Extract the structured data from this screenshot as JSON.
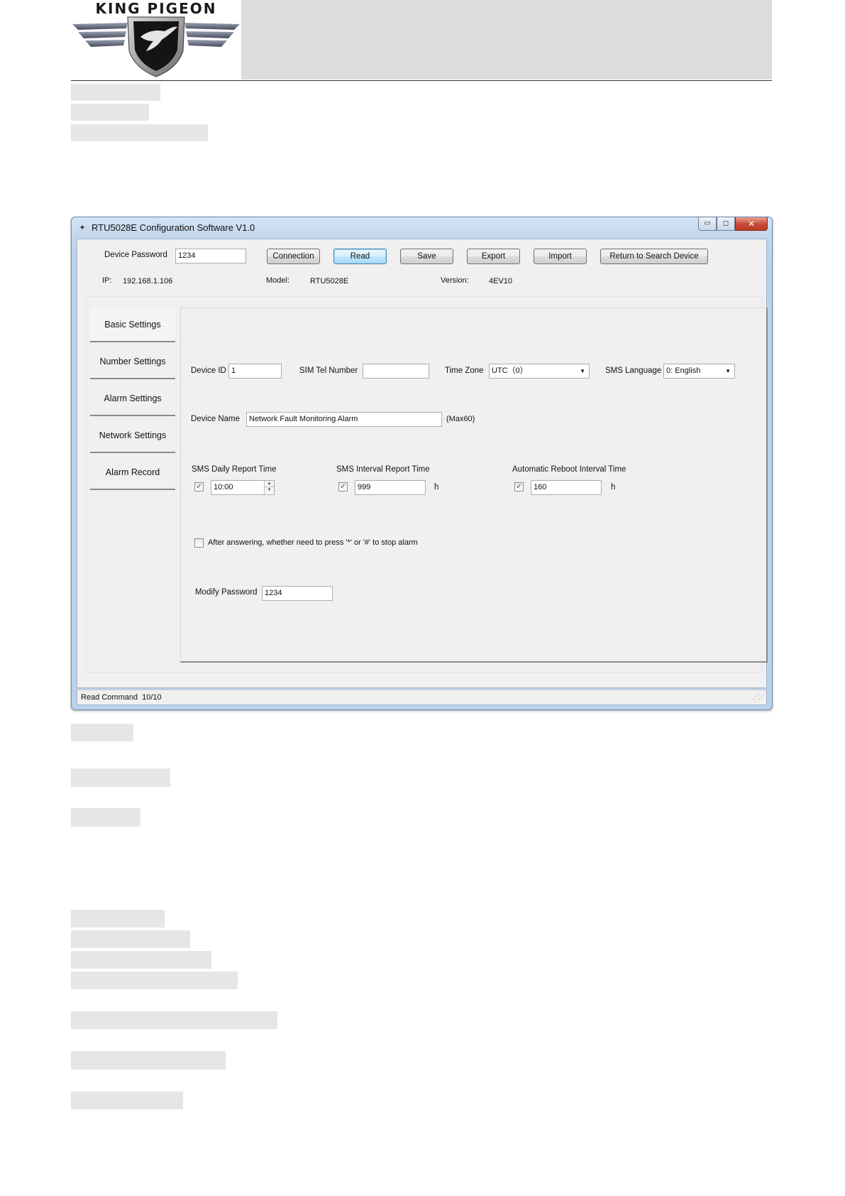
{
  "page": {
    "logo_text": "KING PIGEON"
  },
  "window": {
    "title": "RTU5028E Configuration Software V1.0",
    "title_icon": "app-icon",
    "controls": {
      "minimize": "minimize-icon",
      "maximize": "maximize-icon",
      "close": "close-icon"
    }
  },
  "toolbar": {
    "password_label": "Device Password",
    "password_value": "1234",
    "buttons": {
      "connection": "Connection",
      "read": "Read",
      "save": "Save",
      "export": "Export",
      "import": "Import",
      "return": "Return to Search Device"
    }
  },
  "info": {
    "ip_label": "IP:",
    "ip_value": "192.168.1.106",
    "model_label": "Model:",
    "model_value": "RTU5028E",
    "version_label": "Version:",
    "version_value": "4EV10"
  },
  "tabs": [
    {
      "label": "Basic Settings",
      "active": true
    },
    {
      "label": "Number Settings",
      "active": false
    },
    {
      "label": "Alarm Settings",
      "active": false
    },
    {
      "label": "Network Settings",
      "active": false
    },
    {
      "label": "Alarm Record",
      "active": false
    }
  ],
  "basic": {
    "device_id_label": "Device ID",
    "device_id_value": "1",
    "sim_label": "SIM Tel Number",
    "sim_value": "",
    "timezone_label": "Time Zone",
    "timezone_value": "UTC（0）",
    "sms_lang_label": "SMS Language",
    "sms_lang_value": "0: English",
    "device_name_label": "Device Name",
    "device_name_value": "Network Fault Monitoring Alarm",
    "device_name_hint": "(Max60)",
    "daily_report_label": "SMS Daily Report Time",
    "daily_report_checked": true,
    "daily_report_value": "10:00",
    "interval_report_label": "SMS Interval Report Time",
    "interval_report_checked": true,
    "interval_report_value": "999",
    "interval_unit": "h",
    "reboot_label": "Automatic Reboot Interval Time",
    "reboot_checked": true,
    "reboot_value": "160",
    "reboot_unit": "h",
    "answer_option_label": "After answering, whether need to press '*' or '#' to stop alarm",
    "answer_option_checked": false,
    "modify_pwd_label": "Modify Password",
    "modify_pwd_value": "1234"
  },
  "status": {
    "command": "Read Command",
    "progress": "10/10"
  }
}
